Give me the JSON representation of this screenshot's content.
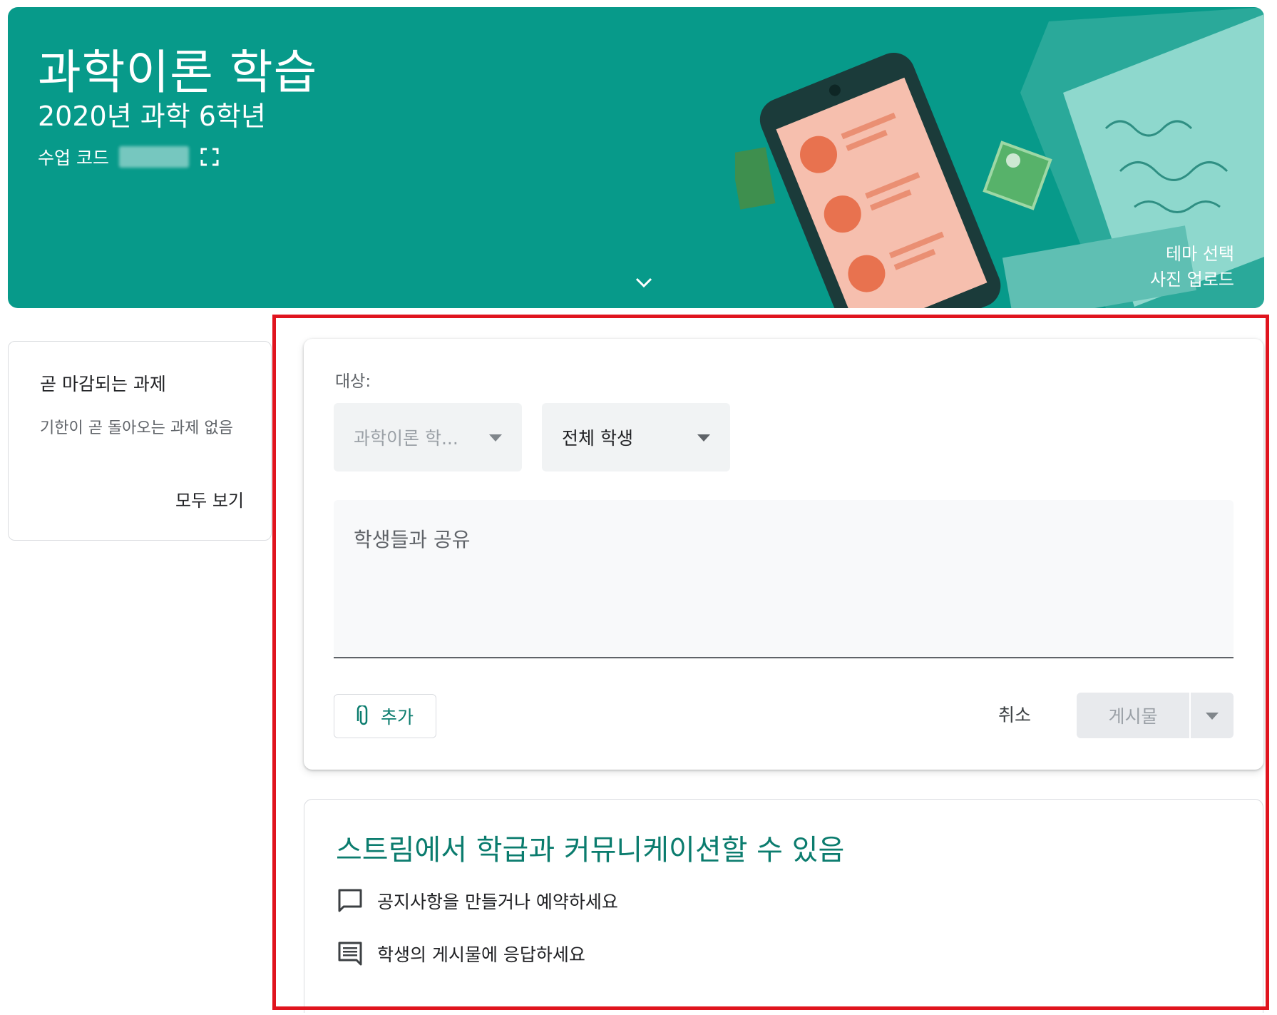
{
  "banner": {
    "title": "과학이론 학습",
    "subtitle": "2020년 과학 6학년",
    "class_code_label": "수업 코드",
    "theme_select": "테마 선택",
    "photo_upload": "사진 업로드",
    "background_color": "#079a8a"
  },
  "upcoming": {
    "title": "곧 마감되는 과제",
    "empty_text": "기한이 곧 돌아오는 과제 없음",
    "view_all": "모두 보기"
  },
  "compose": {
    "for_label": "대상:",
    "class_select": "과학이론 학...",
    "students_select": "전체 학생",
    "placeholder": "학생들과 공유",
    "add_button": "추가",
    "cancel_button": "취소",
    "post_button": "게시물"
  },
  "info": {
    "heading": "스트림에서 학급과 커뮤니케이션할 수 있음",
    "items": [
      {
        "icon": "announcement-icon",
        "text": "공지사항을 만들거나 예약하세요"
      },
      {
        "icon": "reply-comment-icon",
        "text": "학생의 게시물에 응답하세요"
      }
    ]
  },
  "colors": {
    "accent": "#0b7c6e",
    "highlight_outline": "#e0141e"
  }
}
